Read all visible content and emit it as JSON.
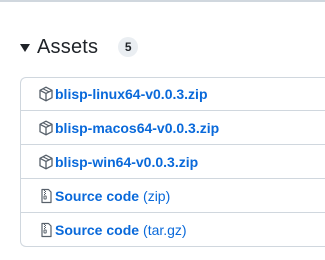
{
  "assets": {
    "title": "Assets",
    "count": "5",
    "items": [
      {
        "icon": "package-icon",
        "name": "blisp-linux64-v0.0.3.zip"
      },
      {
        "icon": "package-icon",
        "name": "blisp-macos64-v0.0.3.zip"
      },
      {
        "icon": "package-icon",
        "name": "blisp-win64-v0.0.3.zip"
      }
    ],
    "sources": [
      {
        "icon": "file-zip-icon",
        "label": "Source code",
        "ext": "(zip)"
      },
      {
        "icon": "file-zip-icon",
        "label": "Source code",
        "ext": "(tar.gz)"
      }
    ]
  },
  "colors": {
    "link": "#0969da",
    "border": "#d0d7de",
    "text": "#1f2328",
    "badge_bg": "#eaeef2"
  }
}
